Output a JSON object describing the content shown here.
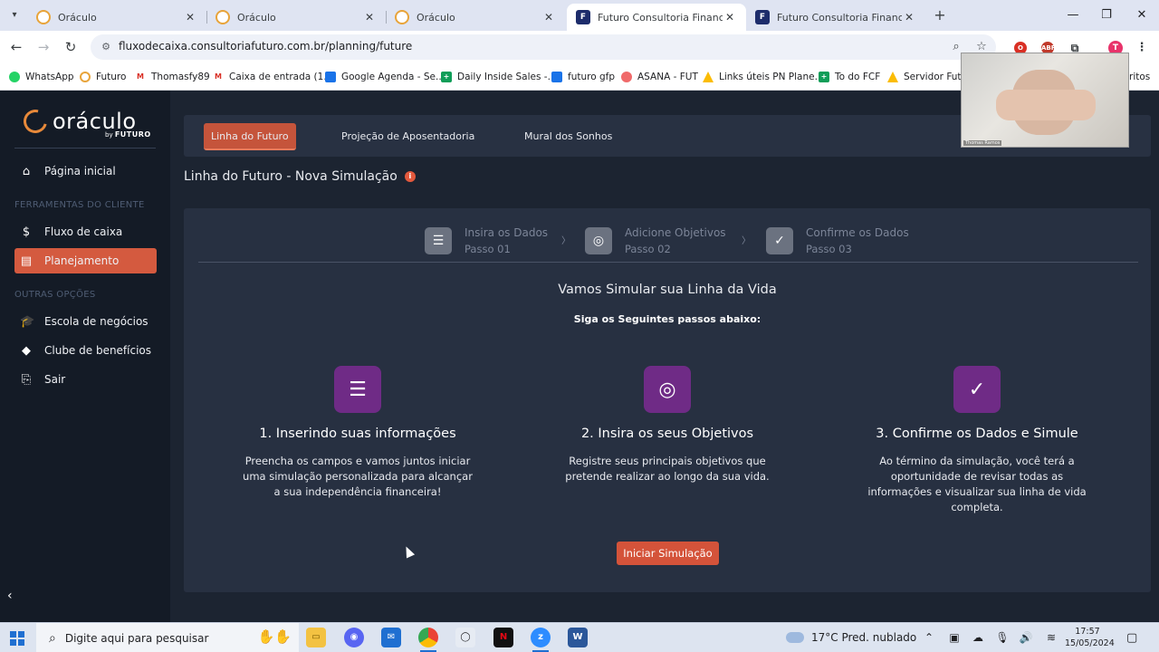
{
  "browser": {
    "tabs": [
      {
        "title": "Oráculo",
        "favicon": "oraculo-favicon",
        "active": false
      },
      {
        "title": "Oráculo",
        "favicon": "oraculo-favicon",
        "active": false
      },
      {
        "title": "Oráculo",
        "favicon": "oraculo-favicon",
        "active": false
      },
      {
        "title": "Futuro Consultoria Financeira",
        "favicon": "futuro-favicon",
        "active": true
      },
      {
        "title": "Futuro Consultoria Financeira",
        "favicon": "futuro-favicon",
        "active": false
      }
    ],
    "url": "fluxodecaixa.consultoriafuturo.com.br/planning/future",
    "profile_initial": "T",
    "extension_abp": "ABP",
    "bookmarks": [
      {
        "label": "WhatsApp",
        "color": "#25d366"
      },
      {
        "label": "Futuro",
        "color": "#e8a43a"
      },
      {
        "label": "Thomasfy89",
        "color": "#d93025"
      },
      {
        "label": "Caixa de entrada (1...",
        "color": "#d93025"
      },
      {
        "label": "Google Agenda - Se...",
        "color": "#1a73e8"
      },
      {
        "label": "Daily Inside Sales -...",
        "color": "#0f9d58"
      },
      {
        "label": "futuro gfp",
        "color": "#1a73e8"
      },
      {
        "label": "ASANA - FUT",
        "color": "#f06a6a"
      },
      {
        "label": "Links úteis PN Plane...",
        "color": "#fbbc04"
      },
      {
        "label": "To do FCF",
        "color": "#0f9d58"
      },
      {
        "label": "Servidor Futur",
        "color": "#fbbc04"
      }
    ],
    "bookmarks_overflow": "ritos"
  },
  "sidebar": {
    "logo": "oráculo",
    "logo_sub_by": "by",
    "logo_sub_brand": "FUTURO",
    "items_main": [
      {
        "label": "Página inicial",
        "icon": "home-icon"
      }
    ],
    "section_client": "FERRAMENTAS DO CLIENTE",
    "items_client": [
      {
        "label": "Fluxo de caixa",
        "icon": "dollar-icon"
      },
      {
        "label": "Planejamento",
        "icon": "list-icon",
        "active": true
      }
    ],
    "section_other": "OUTRAS OPÇÕES",
    "items_other": [
      {
        "label": "Escola de negócios",
        "icon": "graduation-cap-icon"
      },
      {
        "label": "Clube de benefícios",
        "icon": "diamond-icon"
      },
      {
        "label": "Sair",
        "icon": "door-exit-icon"
      }
    ]
  },
  "page_tabs": [
    {
      "label": "Linha do Futuro",
      "active": true
    },
    {
      "label": "Projeção de Aposentadoria",
      "active": false
    },
    {
      "label": "Mural dos Sonhos",
      "active": false
    }
  ],
  "page_title": "Linha do Futuro - Nova Simulação",
  "steps": [
    {
      "title": "Insira os Dados",
      "sub": "Passo 01",
      "icon": "checklist-icon"
    },
    {
      "title": "Adicione Objetivos",
      "sub": "Passo 02",
      "icon": "target-icon"
    },
    {
      "title": "Confirme os Dados",
      "sub": "Passo 03",
      "icon": "check-circle-icon"
    }
  ],
  "headline": "Vamos Simular sua Linha da Vida",
  "subheadline": "Siga os Seguintes passos abaixo:",
  "features": [
    {
      "title": "1. Inserindo suas informações",
      "desc": "Preencha os campos e vamos juntos iniciar uma simulação personalizada para alcançar a sua independência financeira!",
      "icon": "checklist-icon"
    },
    {
      "title": "2. Insira os seus Objetivos",
      "desc": "Registre seus principais objetivos que pretende realizar ao longo da sua vida.",
      "icon": "target-icon"
    },
    {
      "title": "3. Confirme os Dados e Simule",
      "desc": "Ao término da simulação, você terá a oportunidade de revisar todas as informações e visualizar sua linha de vida completa.",
      "icon": "check-circle-icon"
    }
  ],
  "start_button": "Iniciar Simulação",
  "webcam_name": "Thomas Ramos",
  "taskbar": {
    "search_placeholder": "Digite aqui para pesquisar",
    "weather": "17°C  Pred. nublado",
    "time": "17:57",
    "date": "15/05/2024"
  },
  "colors": {
    "accent": "#d4533a",
    "sidebar_bg": "#141b26",
    "app_bg": "#1c2431",
    "card_bg": "#273041",
    "feature_icon_bg": "#6f2b86"
  }
}
